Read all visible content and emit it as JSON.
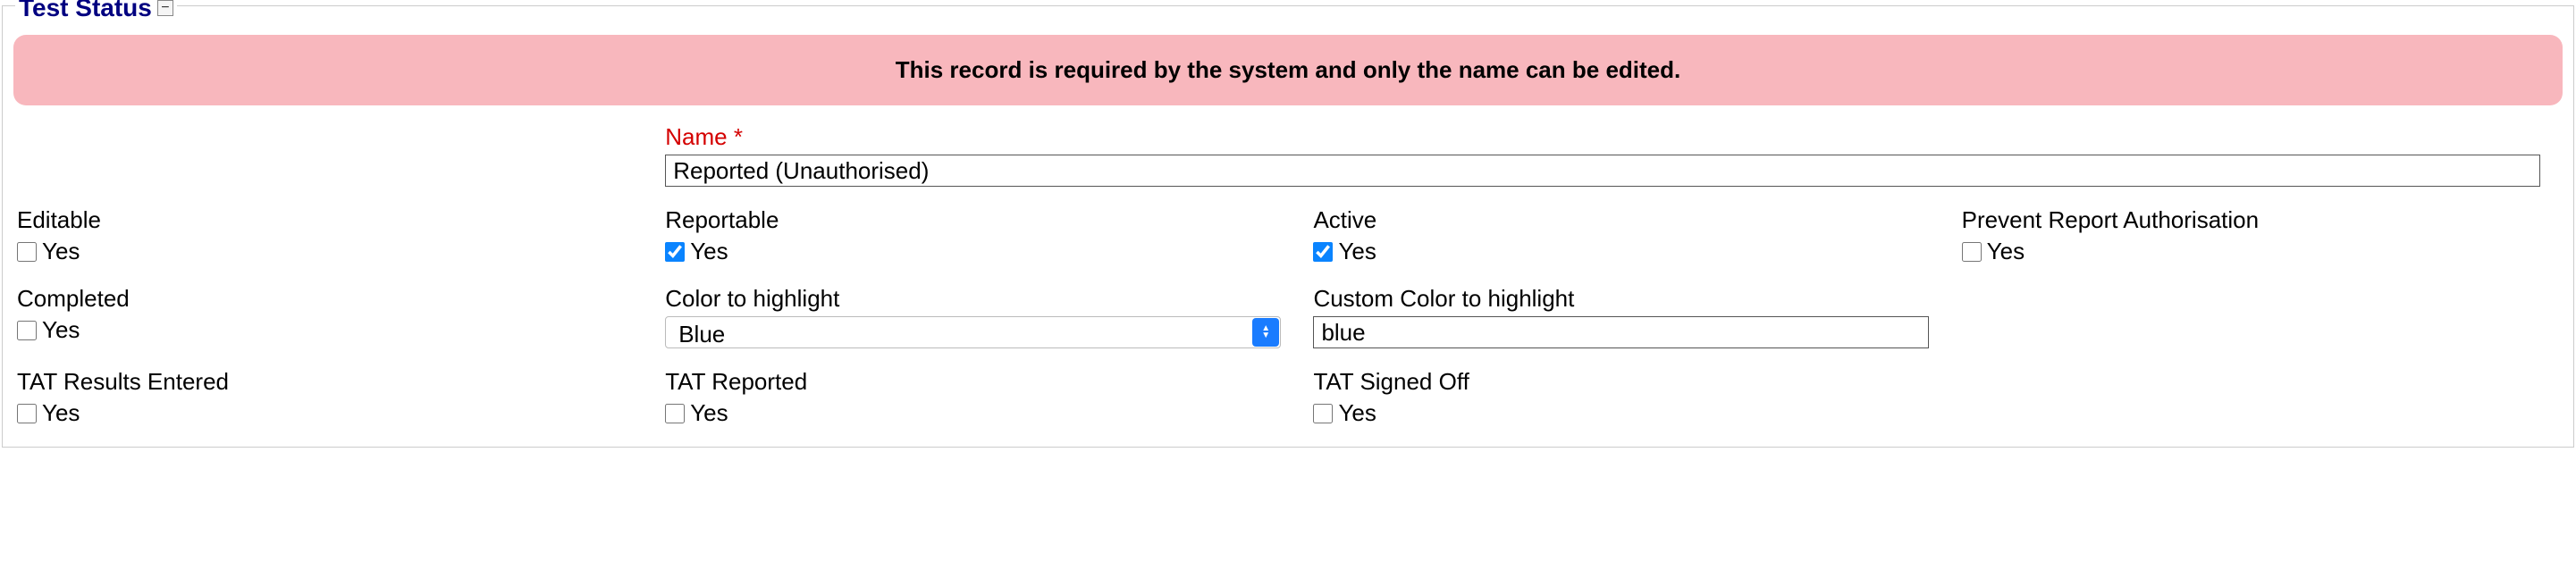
{
  "section": {
    "title": "Test Status",
    "collapse_glyph": "−"
  },
  "alert": {
    "message": "This record is required by the system and only the name can be edited."
  },
  "fields": {
    "name": {
      "label": "Name",
      "asterisk": "*",
      "value": "Reported (Unauthorised)"
    },
    "editable": {
      "label": "Editable",
      "option_label": "Yes",
      "checked": false
    },
    "reportable": {
      "label": "Reportable",
      "option_label": "Yes",
      "checked": true
    },
    "active": {
      "label": "Active",
      "option_label": "Yes",
      "checked": true
    },
    "prevent_report_auth": {
      "label": "Prevent Report Authorisation",
      "option_label": "Yes",
      "checked": false
    },
    "completed": {
      "label": "Completed",
      "option_label": "Yes",
      "checked": false
    },
    "color_highlight": {
      "label": "Color to highlight",
      "value": "Blue"
    },
    "custom_color": {
      "label": "Custom Color to highlight",
      "value": "blue"
    },
    "tat_results_entered": {
      "label": "TAT Results Entered",
      "option_label": "Yes",
      "checked": false
    },
    "tat_reported": {
      "label": "TAT Reported",
      "option_label": "Yes",
      "checked": false
    },
    "tat_signed_off": {
      "label": "TAT Signed Off",
      "option_label": "Yes",
      "checked": false
    }
  }
}
